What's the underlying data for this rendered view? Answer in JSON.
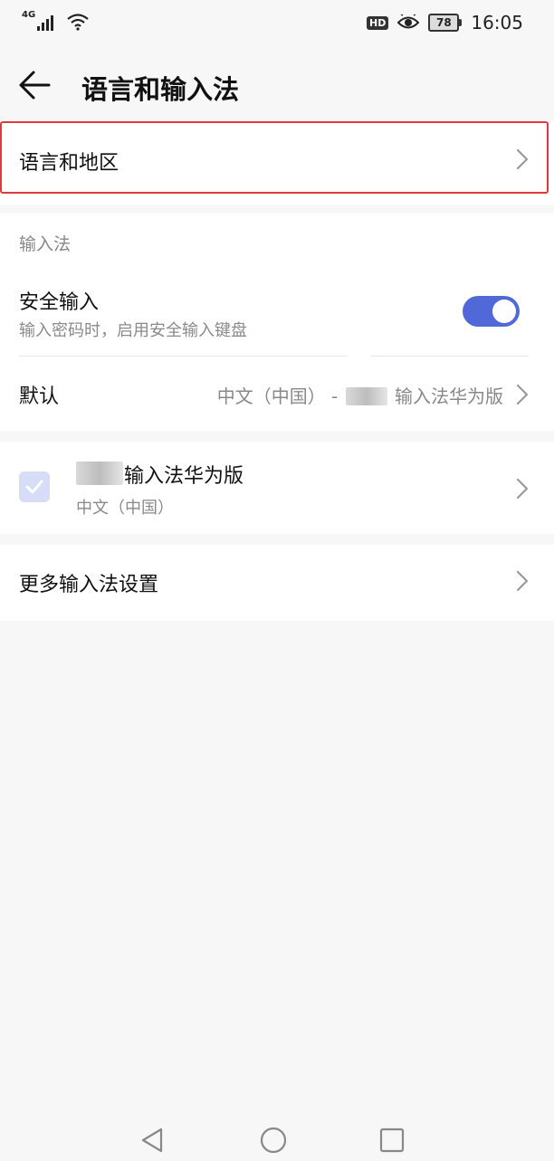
{
  "status_bar": {
    "network": "4G",
    "badge": "HD",
    "battery": "78",
    "time": "16:05"
  },
  "header": {
    "title": "语言和输入法"
  },
  "language_region": {
    "label": "语言和地区"
  },
  "input_section": {
    "title": "输入法",
    "secure_input": {
      "label": "安全输入",
      "description": "输入密码时，启用安全输入键盘",
      "enabled": true
    },
    "default": {
      "label": "默认",
      "value_prefix": "中文（中国） -",
      "value_suffix": "输入法华为版"
    }
  },
  "keyboard_item": {
    "name": "输入法华为版",
    "locale": "中文（中国）",
    "checked": true
  },
  "more_settings": {
    "label": "更多输入法设置"
  },
  "colors": {
    "accent": "#5068d8",
    "highlight_border": "#e23a3a"
  },
  "icons": {
    "back": "arrow-left-icon",
    "chevron": "chevron-right-icon",
    "wifi": "wifi-icon",
    "eye": "eye-icon",
    "signal": "signal-icon"
  }
}
